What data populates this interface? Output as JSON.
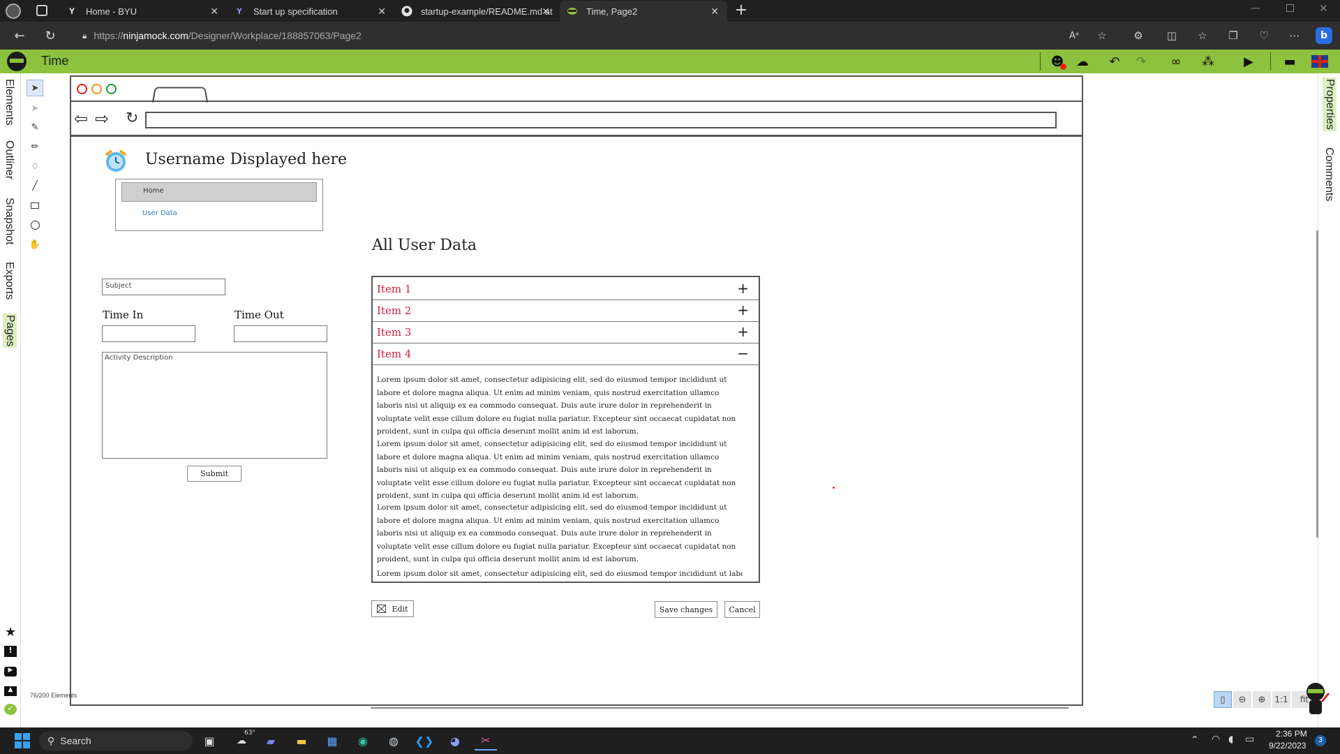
{
  "browser": {
    "tabs": [
      {
        "label": "Home - BYU",
        "favicon": "Y"
      },
      {
        "label": "Start up specification",
        "favicon": "Y"
      },
      {
        "label": "startup-example/README.md at",
        "favicon": "github-icon"
      },
      {
        "label": "Time, Page2",
        "favicon": "ninja-icon"
      }
    ],
    "url_prefix": "https://",
    "url_host": "ninjamock.com",
    "url_path": "/Designer/Workplace/188857063/Page2"
  },
  "app": {
    "title": "Time",
    "accent": "#8cc23d",
    "left_tabs": [
      "Elements",
      "Outliner",
      "Snapshot",
      "Exports",
      "Pages"
    ],
    "right_tabs": [
      "Properties",
      "Comments"
    ],
    "element_count": "76/200 Elements",
    "zoom": {
      "one_to_one": "1:1",
      "fit": "fit"
    }
  },
  "mockup": {
    "username": "Username Displayed here",
    "menu": {
      "home": "Home",
      "user_data": "User Data"
    },
    "form": {
      "subject_placeholder": "Subject",
      "time_in": "Time In",
      "time_out": "Time Out",
      "activity_placeholder": "Activity Description",
      "submit": "Submit"
    },
    "section_title": "All User Data",
    "accordion": [
      {
        "label": "Item 1",
        "sign": "+"
      },
      {
        "label": "Item 2",
        "sign": "+"
      },
      {
        "label": "Item 3",
        "sign": "+"
      },
      {
        "label": "Item 4",
        "sign": "−"
      }
    ],
    "lorem": "Lorem ipsum dolor sit amet, consectetur adipisicing elit, sed do eiusmod tempor incididunt ut labore et dolore magna aliqua. Ut enim ad minim veniam, quis nostrud exercitation ullamco laboris nisi ut aliquip ex ea commodo consequat. Duis aute irure dolor in reprehenderit in voluptate velit esse cillum dolore eu fugiat nulla pariatur. Excepteur sint occaecat cupidatat non proident, sunt in culpa qui officia deserunt mollit anim id est laborum.",
    "lorem_partial": "Lorem ipsum dolor sit amet, consectetur adipisicing elit, sed do eiusmod tempor incididunt ut labore et dolore",
    "buttons": {
      "edit": "Edit",
      "save": "Save changes",
      "cancel": "Cancel"
    }
  },
  "taskbar": {
    "search": "Search",
    "weather": "63°",
    "time": "2:36 PM",
    "date": "9/22/2023",
    "notifications": "3"
  }
}
